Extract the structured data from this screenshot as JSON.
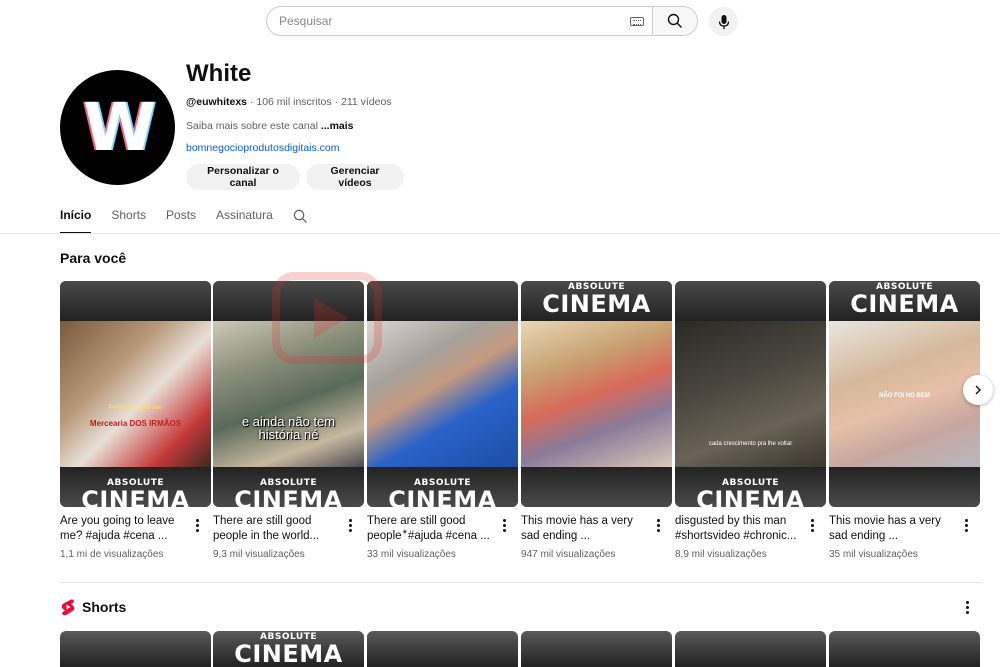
{
  "search": {
    "placeholder": "Pesquisar"
  },
  "channel": {
    "avatar_letter": "W",
    "name": "White",
    "handle": "@euwhitexs",
    "subscribers": "106 mil inscritos",
    "videos": "211 vídeos",
    "about_text": "Saiba mais sobre este canal",
    "about_more": "...mais",
    "link": "bomnegocioprodutosdigitais.com",
    "customize_label": "Personalizar o canal",
    "manage_label": "Gerenciar vídeos"
  },
  "tabs": [
    {
      "label": "Início",
      "active": true
    },
    {
      "label": "Shorts",
      "active": false
    },
    {
      "label": "Posts",
      "active": false
    },
    {
      "label": "Assinatura",
      "active": false
    }
  ],
  "section_for_you": "Para você",
  "thumb_text": {
    "absolute": "ABSOLUTE",
    "cinema": "CINEMA",
    "card1_caption_1": "Pensou mesmo não",
    "card1_caption_2": "Mercearia DOS IRMÃOS",
    "card2_overlay": "e ainda não tem história né",
    "card5_caption": "cada crescimento pra lhe voltar",
    "card6_caption": "NÃO FOI NO BEM"
  },
  "videos": [
    {
      "title": "Are you going to leave me? #ajuda #cena ...",
      "views": "1,1 mi de visualizações"
    },
    {
      "title": "There are still good people in the world...",
      "views": "9,3 mil visualizações"
    },
    {
      "title": "There are still good people ⃰ #ajuda #cena ...",
      "views": "33 mil visualizações"
    },
    {
      "title": "This movie has a very sad ending ...",
      "views": "947 mil visualizações"
    },
    {
      "title": "disgusted by this man #shortsvideo #chronic...",
      "views": "8,9 mil visualizações"
    },
    {
      "title": "This movie has a very sad ending ...",
      "views": "35 mil visualizações"
    }
  ],
  "shorts_title": "Shorts",
  "colors": {
    "shorts_red": "#ff0033",
    "link_blue": "#065fd4",
    "watermark_red": "#e0302a"
  },
  "icons": [
    "keyboard-icon",
    "search-icon",
    "mic-icon",
    "chevron-right-icon",
    "more-vert-icon",
    "shorts-icon"
  ]
}
